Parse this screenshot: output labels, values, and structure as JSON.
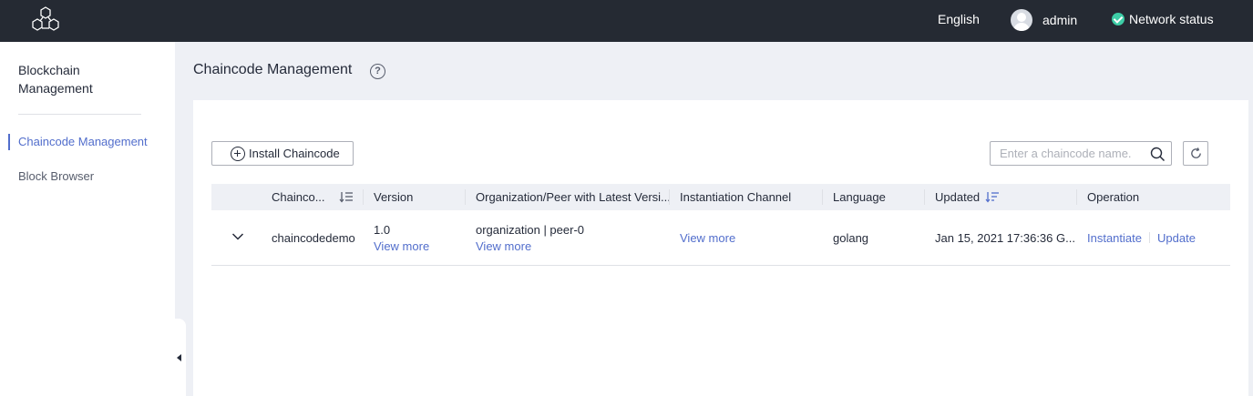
{
  "topbar": {
    "language": "English",
    "username": "admin",
    "network_status": "Network status",
    "logo_icon": "hexagon-cluster-logo",
    "status_color": "#3dcca6"
  },
  "sidebar": {
    "title": "Blockchain Management",
    "items": [
      {
        "label": "Chaincode Management",
        "active": true
      },
      {
        "label": "Block Browser",
        "active": false
      }
    ]
  },
  "page": {
    "title": "Chaincode Management",
    "help_icon": "?"
  },
  "toolbar": {
    "install_label": "Install Chaincode",
    "search_placeholder": "Enter a chaincode name.",
    "search_value": ""
  },
  "table": {
    "columns": [
      "Chainco...",
      "Version",
      "Organization/Peer with Latest Versi...",
      "Instantiation Channel",
      "Language",
      "Updated",
      "Operation"
    ],
    "rows": [
      {
        "name": "chaincodedemo",
        "version": "1.0",
        "version_link": "View more",
        "org_peer": "organization | peer-0",
        "org_link": "View more",
        "channel_link": "View more",
        "language": "golang",
        "updated": "Jan 15, 2021 17:36:36 G...",
        "op_instantiate": "Instantiate",
        "op_update": "Update"
      }
    ]
  },
  "colors": {
    "accent": "#526ecc",
    "topbar": "#252a33",
    "background": "#eef0f5"
  }
}
